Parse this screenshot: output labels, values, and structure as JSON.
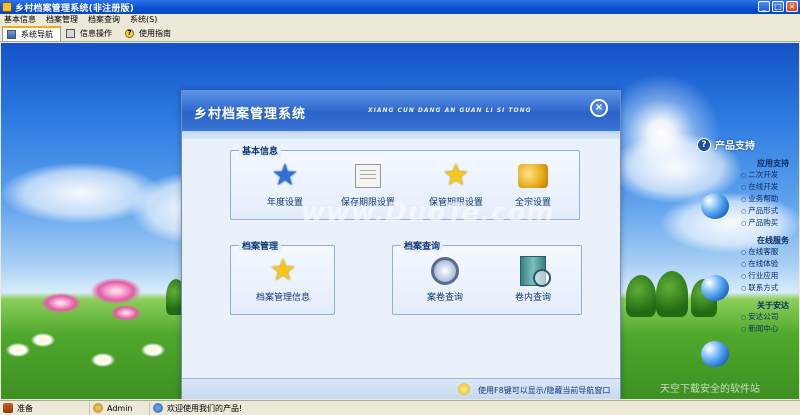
{
  "window": {
    "title": "乡村档案管理系统(非注册版)",
    "btn_min": "_",
    "btn_max": "□",
    "btn_close": "×"
  },
  "menu": [
    "基本信息",
    "档案管理",
    "档案查询",
    "系统(S)"
  ],
  "tabs": [
    {
      "label": "系统导航",
      "icon": "navigation-icon",
      "active": true
    },
    {
      "label": "信息操作",
      "icon": "document-icon",
      "active": false
    },
    {
      "label": "使用指南",
      "icon": "help-icon",
      "active": false
    }
  ],
  "panel": {
    "title": "乡村档案管理系统",
    "pinyin": "XIANG CUN DANG AN GUAN LI SI TONG",
    "close_glyph": "×",
    "groups": {
      "basic": {
        "label": "基本信息",
        "items": [
          {
            "label": "年度设置",
            "icon": "blue-star-icon"
          },
          {
            "label": "保存期限设置",
            "icon": "document-edit-icon"
          },
          {
            "label": "保管期限设置",
            "icon": "gold-star-icon"
          },
          {
            "label": "全宗设置",
            "icon": "coins-icon"
          }
        ]
      },
      "archive": {
        "label": "档案管理",
        "items": [
          {
            "label": "档案管理信息",
            "icon": "gold-star-icon"
          }
        ]
      },
      "query": {
        "label": "档案查询",
        "items": [
          {
            "label": "案卷查询",
            "icon": "magnifier-icon"
          },
          {
            "label": "卷内查询",
            "icon": "book-search-icon"
          }
        ]
      }
    },
    "footer": "使用F8键可以显示/隐藏当前导航窗口"
  },
  "watermark": "www.DuoTe.com",
  "support": {
    "title": "产品支持",
    "q_glyph": "?",
    "sections": [
      {
        "title": "应用支持",
        "links": [
          "二次开发",
          "在线开发",
          "业务帮助",
          "产品形式",
          "产品购买"
        ]
      },
      {
        "title": "在线服务",
        "links": [
          "在线客服",
          "在线体验",
          "行业应用",
          "联系方式"
        ]
      },
      {
        "title": "关于安达",
        "links": [
          "安达公司",
          "新闻中心"
        ]
      }
    ]
  },
  "corner_watermark": "天空下载安全的软件站",
  "status": [
    "准备",
    "Admin",
    "欢迎使用我们的产品!"
  ]
}
